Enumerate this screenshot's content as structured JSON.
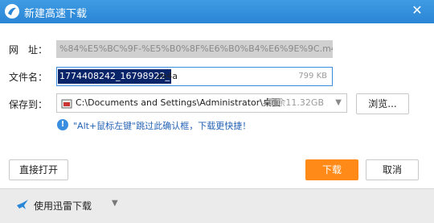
{
  "window": {
    "title": "新建高速下载",
    "close_glyph": "✕"
  },
  "url_row": {
    "label": "网　址：",
    "value": "%84%E5%BC%9F-%E5%B0%8F%E6%B0%B4%E6%9E%9C.m4a"
  },
  "filename_row": {
    "label": "文件名：",
    "selected_text": "1774408242_16798922_",
    "extension": ".m4a",
    "size": "799 KB"
  },
  "save_row": {
    "label": "保存到：",
    "path": "C:\\Documents and Settings\\Administrator\\桌面",
    "free_space": "剩余11.32GB",
    "browse_label": "浏览..."
  },
  "hint": {
    "icon_glyph": "!",
    "text": "\"Alt+鼠标左键\"跳过此确认框，下载更快捷！"
  },
  "buttons": {
    "open_direct": "直接打开",
    "download": "下载",
    "cancel": "取消"
  },
  "footer": {
    "label": "使用迅雷下载",
    "chevron": "▼"
  },
  "colors": {
    "titlebar": "#2a86d6",
    "download_button": "#ff8a18",
    "hint_text": "#2563b6"
  }
}
